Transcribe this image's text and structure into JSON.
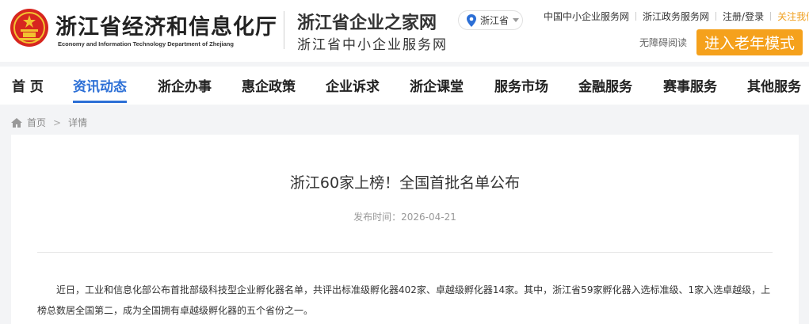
{
  "header": {
    "department_cn": "浙江省经济和信息化厅",
    "department_en": "Economy and Information Technology Department of Zhejiang",
    "site_title": "浙江省企业之家网",
    "site_subtitle": "浙江省中小企业服务网",
    "location": "浙江省",
    "top_links": [
      "中国中小企业服务网",
      "浙江政务服务网",
      "注册/登录",
      "关注我们"
    ],
    "accessibility": "无障碍阅读",
    "elder_mode": "进入老年模式",
    "colors": {
      "accent": "#2c6fd6",
      "orange": "#f5a11c",
      "emblem_red": "#d7261f"
    }
  },
  "nav": {
    "items": [
      "首 页",
      "资讯动态",
      "浙企办事",
      "惠企政策",
      "企业诉求",
      "浙企课堂",
      "服务市场",
      "金融服务",
      "赛事服务",
      "其他服务"
    ],
    "active": "资讯动态"
  },
  "breadcrumb": {
    "home": "首页",
    "current": "详情"
  },
  "article": {
    "title": "浙江60家上榜！全国首批名单公布",
    "publish_label": "发布时间",
    "publish_date": "2026-04-21",
    "body": "近日，工业和信息化部公布首批部级科技型企业孵化器名单，共评出标准级孵化器402家、卓越级孵化器14家。其中，浙江省59家孵化器入选标准级、1家入选卓越级，上榜总数居全国第二，成为全国拥有卓越级孵化器的五个省份之一。"
  }
}
